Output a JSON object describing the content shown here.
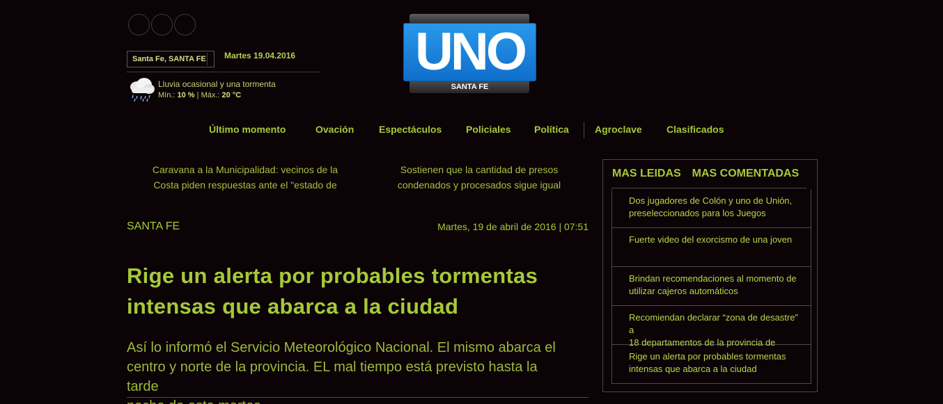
{
  "header": {
    "city": "Santa Fe, SANTA FE",
    "date": "Martes 19.04.2016",
    "weather": {
      "description": "Lluvia ocasional y una tormenta",
      "min_label": "Mín.:",
      "min_value": "10 %",
      "sep": "|",
      "max_label": "Máx.:",
      "max_value": "20",
      "unit": "°C"
    },
    "logo": {
      "word": "UNO",
      "sub": "SANTA FE"
    }
  },
  "nav": {
    "items": [
      "Último momento",
      "Ovación",
      "Espectáculos",
      "Policiales",
      "Política",
      "Agroclave",
      "Clasificados"
    ]
  },
  "teasers": [
    {
      "line1": "Caravana a la Municipalidad: vecinos de la",
      "line2": "Costa piden respuestas ante el \"estado de"
    },
    {
      "line1": "Sostienen que la cantidad de presos",
      "line2": "condenados y procesados sigue igual"
    }
  ],
  "article": {
    "section": "SANTA FE",
    "timestamp": "Martes, 19 de abril de 2016 | 07:51",
    "headline_l1": "Rige un alerta por probables tormentas",
    "headline_l2": "intensas que abarca a la ciudad",
    "lead_l1": "Así lo informó el Servicio Meteorológico Nacional. El mismo abarca el",
    "lead_l2": "centro y norte de la provincia. EL mal tiempo está previsto hasta la tarde",
    "lead_l3": "noche de este martes."
  },
  "sidebar": {
    "tab_most_read": "MAS LEIDAS",
    "tab_most_commented": "MAS COMENTADAS",
    "items": [
      {
        "l1": "Dos jugadores de Colón y uno de Unión,",
        "l2": " preseleccionados para los Juegos"
      },
      {
        "l1": "Fuerte video del exorcismo de una joven",
        "l2": ""
      },
      {
        "l1": "Brindan recomendaciones al momento de",
        "l2": " utilizar cajeros automáticos"
      },
      {
        "l1": "Recomiendan declarar “zona de desastre” a",
        "l2": "18 departamentos de la provincia de"
      },
      {
        "l1": "Rige un alerta por probables tormentas",
        "l2": " intensas que abarca a la ciudad"
      }
    ]
  }
}
